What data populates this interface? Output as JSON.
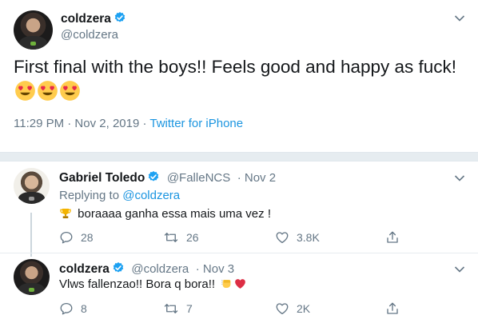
{
  "main_tweet": {
    "author_name": "coldzera",
    "author_handle": "@coldzera",
    "text": "First final with the boys!! Feels good and happy as fuck!",
    "emoji_names": [
      "heart-eyes-emoji",
      "heart-eyes-emoji",
      "heart-eyes-emoji"
    ],
    "timestamp": "11:29 PM · Nov 2, 2019 · ",
    "client": "Twitter for iPhone"
  },
  "replies": [
    {
      "author_name": "Gabriel Toledo",
      "author_handle": "@FalleNCS",
      "date": "· Nov 2",
      "replying_prefix": "Replying to ",
      "replying_to": "@coldzera",
      "text": "boraaaa ganha essa mais uma vez !",
      "leading_emoji": "trophy-emoji",
      "counts": {
        "reply": "28",
        "retweet": "26",
        "like": "3.8K"
      }
    },
    {
      "author_name": "coldzera",
      "author_handle": "@coldzera",
      "date": "· Nov 3",
      "text": "Vlws fallenzao!! Bora q bora!!",
      "trailing_emojis": [
        "fist-bump-emoji",
        "red-heart-emoji"
      ],
      "counts": {
        "reply": "8",
        "retweet": "7",
        "like": "2K"
      }
    }
  ],
  "colors": {
    "text": "#14171a",
    "secondary": "#657786",
    "link": "#1b95e0",
    "verified": "#1da1f2",
    "divider": "#e6ecf0"
  }
}
